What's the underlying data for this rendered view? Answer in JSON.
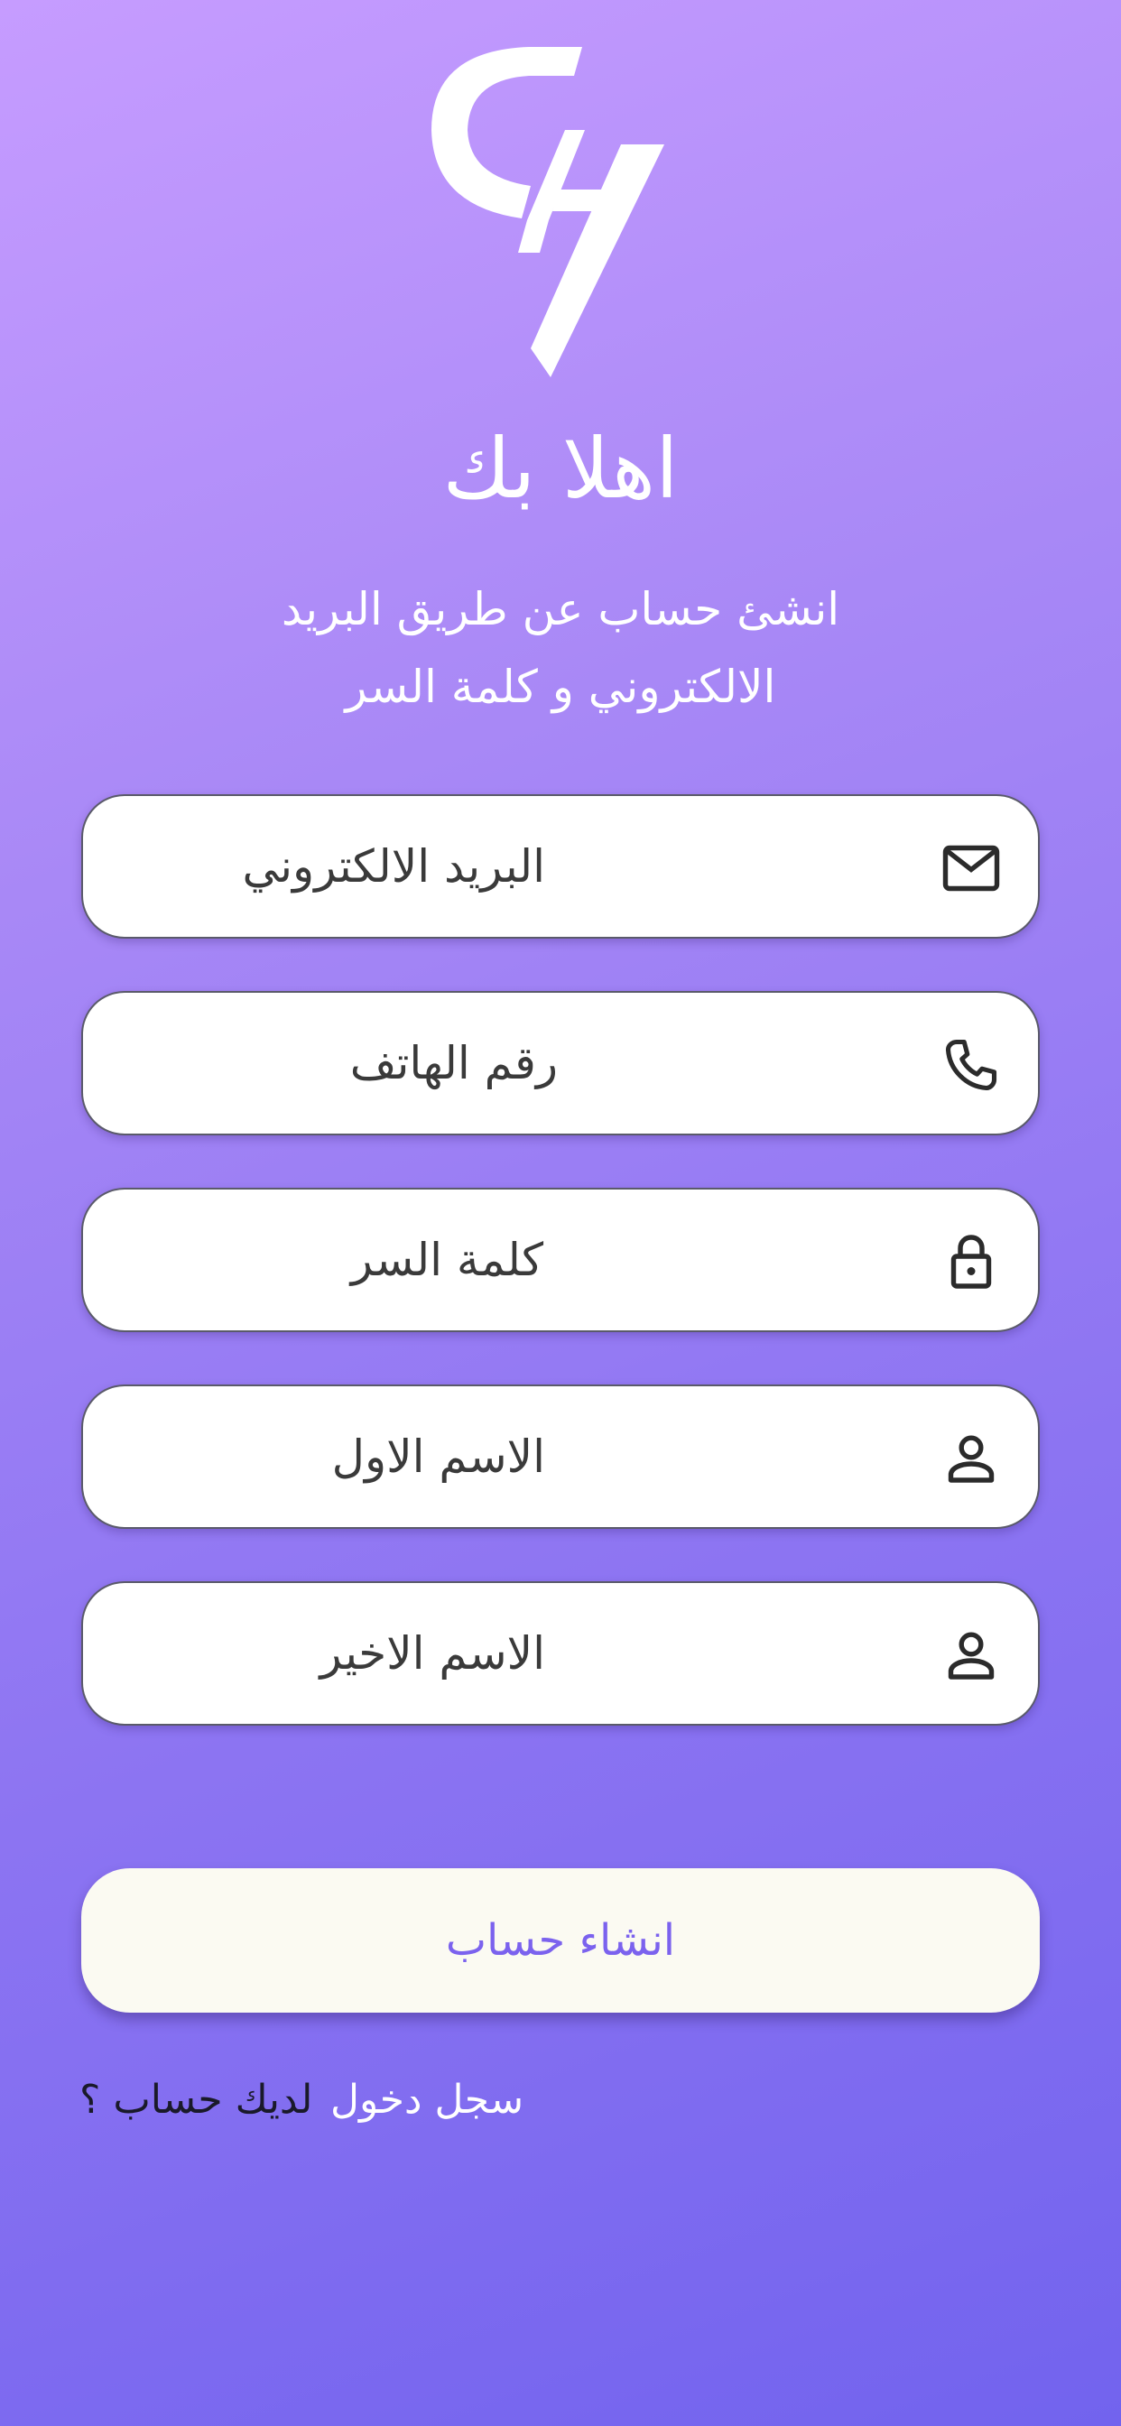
{
  "logo": {
    "name": "ch-monogram-logo"
  },
  "header": {
    "title": "اهلا بك",
    "subtitle_line1": "انشئ حساب عن طريق البريد",
    "subtitle_line2": "الالكتروني و كلمة السر"
  },
  "form": {
    "email": {
      "placeholder": "البريد الالكتروني",
      "icon": "mail-icon"
    },
    "phone": {
      "placeholder": "رقم الهاتف",
      "icon": "phone-icon"
    },
    "password": {
      "placeholder": "كلمة السر",
      "icon": "lock-icon"
    },
    "first_name": {
      "placeholder": "الاسم الاول",
      "icon": "person-icon"
    },
    "last_name": {
      "placeholder": "الاسم الاخير",
      "icon": "person-icon"
    }
  },
  "actions": {
    "create_account_label": "انشاء حساب"
  },
  "footer": {
    "question": "لديك حساب ؟",
    "login_link": "سجل دخول"
  },
  "colors": {
    "gradient_top": "#c69cff",
    "gradient_bottom": "#7263ee",
    "button_bg": "#fbfaf2",
    "button_text": "#7b62ee",
    "field_bg": "#ffffff"
  }
}
